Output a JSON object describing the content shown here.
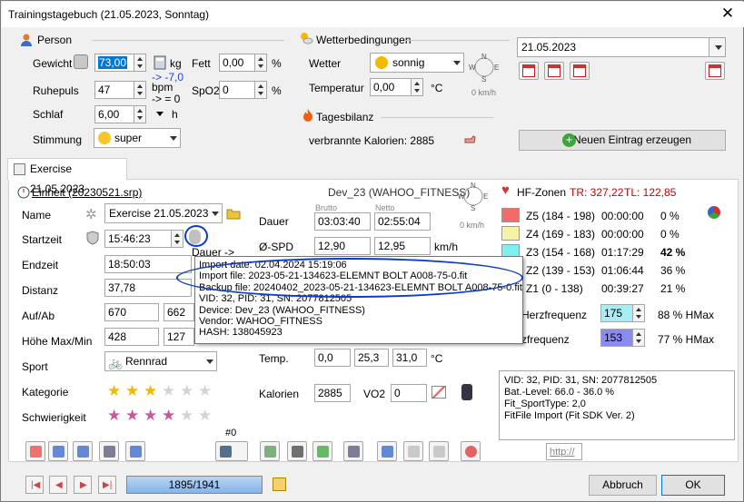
{
  "window": {
    "title": "Trainingstagebuch (21.05.2023, Sonntag)",
    "close": "✕"
  },
  "person": {
    "header": "Person",
    "weight_label": "Gewicht",
    "weight": "73,00",
    "weight_unit": "kg",
    "weight_delta": "-> -7,0",
    "rest_pulse_label": "Ruhepuls",
    "rest_pulse": "47",
    "rest_pulse_unit": "bpm",
    "rest_pulse_delta": "-> = 0",
    "sleep_label": "Schlaf",
    "sleep": "6,00",
    "sleep_unit": "h",
    "fat_label": "Fett",
    "fat": "0,00",
    "fat_unit": "%",
    "spo2_label": "SpO2",
    "spo2": "0",
    "spo2_unit": "%",
    "mood_label": "Stimmung",
    "mood": "super"
  },
  "weather": {
    "header": "Wetterbedingungen",
    "weather_label": "Wetter",
    "weather": "sonnig",
    "temp_label": "Temperatur",
    "temp": "0,00",
    "temp_unit": "°C",
    "wind": "0 km/h"
  },
  "balance": {
    "header": "Tagesbilanz",
    "calories": "verbrannte Kalorien: 2885"
  },
  "date": {
    "value": "21.05.2023"
  },
  "new_entry": "Neuen Eintrag erzeugen",
  "tab": {
    "label": "Exercise 21.05.2023"
  },
  "unit": {
    "label": "Einheit (20230521.srp)",
    "device": "Dev_23 (WAHOO_FITNESS)",
    "wind": "0 km/h"
  },
  "exercise": {
    "name_label": "Name",
    "name": "Exercise 21.05.2023",
    "start_label": "Startzeit",
    "start": "15:46:23",
    "end_label": "Endzeit",
    "end": "18:50:03",
    "distance_label": "Distanz",
    "distance": "37,78",
    "updown_label": "Auf/Ab",
    "up": "670",
    "down": "662",
    "height_label": "Höhe Max/Min",
    "hmax": "428",
    "hmin": "127",
    "sport_label": "Sport",
    "sport": "Rennrad",
    "category_label": "Kategorie",
    "difficulty_label": "Schwierigkeit",
    "page_count": "#0"
  },
  "stats": {
    "brutto": "Brutto",
    "netto": "Netto",
    "duration_label": "Dauer",
    "duration_brutto": "03:03:40",
    "duration_netto": "02:55:04",
    "dauer_arrow": "Dauer ->",
    "spd_label": "Ø-SPD",
    "spd_brutto": "12,90",
    "spd_netto": "12,95",
    "spd_unit": "km/h",
    "temp_label": "Temp.",
    "temp1": "0,0",
    "temp2": "25,3",
    "temp3": "31,0",
    "temp_unit": "°C",
    "cal_label": "Kalorien",
    "cal": "2885",
    "vo2_label": "VO2",
    "vo2": "0"
  },
  "hr": {
    "header": "HF-Zonen",
    "tr": "TR: 327,22",
    "tl": "TL: 122,85",
    "zones": [
      {
        "label": "Z5 (184 - 198)",
        "time": "00:00:00",
        "pct": "0 %",
        "color": "#f26b6b"
      },
      {
        "label": "Z4 (169 - 183)",
        "time": "00:00:00",
        "pct": "0 %",
        "color": "#f5f3a6"
      },
      {
        "label": "Z3 (154 - 168)",
        "time": "01:17:29",
        "pct": "42 %",
        "color": "#7ff0f0"
      },
      {
        "label": "Z2 (139 - 153)",
        "time": "01:06:44",
        "pct": "36 %",
        "color": "#c8f0c0"
      },
      {
        "label": "Z1 (0 - 138)",
        "time": "00:39:27",
        "pct": "21 %",
        "color": "#d8d8d8"
      }
    ],
    "max_label": "-Herzfrequenz",
    "max": "175",
    "max_pct": "88 % HMax",
    "avg_label": "rzfrequenz",
    "avg": "153",
    "avg_pct": "77 % HMax"
  },
  "tooltip": {
    "l1": "Import date: 02.04.2024 15:19:06",
    "l2": "Import file: 2023-05-21-134623-ELEMNT BOLT A008-75-0.fit",
    "l3": "Backup file: 20240402_2023-05-21-134623-ELEMNT BOLT A008-75-0.fit",
    "l4": "VID: 32, PID: 31, SN: 2077812505",
    "l5": "Device: Dev_23 (WAHOO_FITNESS)",
    "l6": "Vendor: WAHOO_FITNESS",
    "l7": "HASH: 138045923"
  },
  "info": {
    "l1": "VID: 32, PID: 31, SN: 2077812505",
    "l2": "Bat.-Level: 66.0 - 36.0 %",
    "l3": "Fit_SportType: 2,0",
    "l4": "FitFile Import (Fit SDK Ver. 2)"
  },
  "url": "http://",
  "footer": {
    "progress": "1895/1941",
    "progress_value": 0.976,
    "cancel": "Abbruch",
    "ok": "OK"
  },
  "colors": {
    "accent": "#0078d7",
    "zone_red": "#cc0000"
  }
}
